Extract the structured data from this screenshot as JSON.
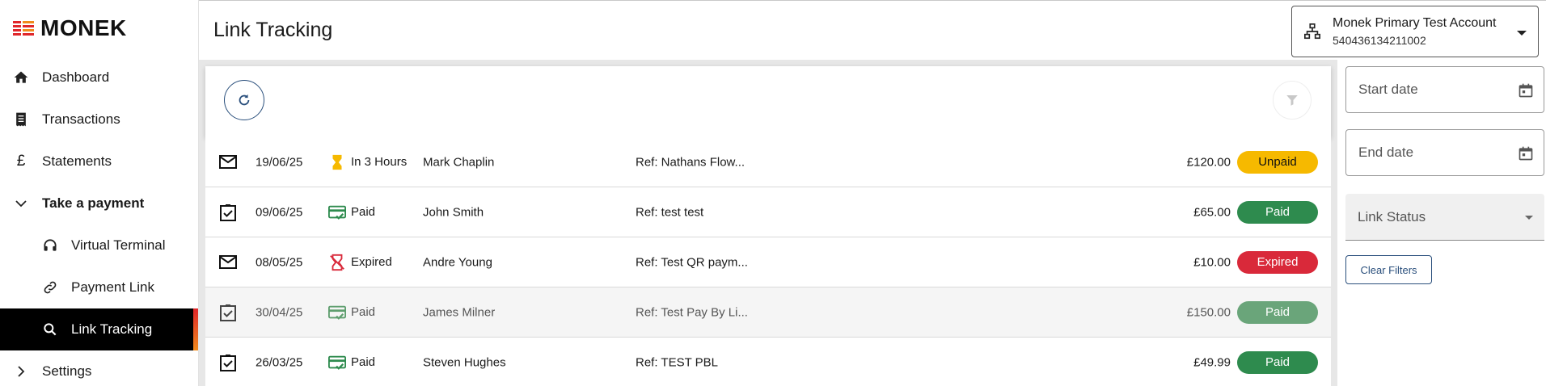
{
  "brand": {
    "name": "MONEK"
  },
  "sidebar": {
    "items": [
      {
        "label": "Dashboard",
        "icon": "home-icon"
      },
      {
        "label": "Transactions",
        "icon": "receipt-icon"
      },
      {
        "label": "Statements",
        "icon": "pound-icon"
      },
      {
        "label": "Take a payment",
        "icon": "chevron-down-icon"
      },
      {
        "label": "Virtual Terminal",
        "icon": "headset-icon"
      },
      {
        "label": "Payment Link",
        "icon": "link-icon"
      },
      {
        "label": "Link Tracking",
        "icon": "search-list-icon"
      },
      {
        "label": "Settings",
        "icon": "chevron-right-icon"
      }
    ]
  },
  "header": {
    "title": "Link Tracking",
    "account": {
      "name": "Monek Primary Test Account",
      "id": "540436134211002"
    }
  },
  "colors": {
    "unpaid": "#f6b900",
    "paid": "#2e8b4e",
    "paid_hover": "#6aa57a",
    "expired": "#d9293a",
    "accent_blue": "#2a4f7c",
    "pending_icon": "#f6b900",
    "paid_icon": "#2e8b4e",
    "expired_icon": "#d9293a"
  },
  "links": [
    {
      "type_icon": "mail-icon",
      "date": "19/06/25",
      "status_icon": "hourglass-icon",
      "status_text": "In 3 Hours",
      "name": "Mark Chaplin",
      "ref": "Ref: Nathans Flow...",
      "amount": "£120.00",
      "badge": "Unpaid"
    },
    {
      "type_icon": "checklist-icon",
      "date": "09/06/25",
      "status_icon": "card-check-icon",
      "status_text": "Paid",
      "name": "John Smith",
      "ref": "Ref: test test",
      "amount": "£65.00",
      "badge": "Paid"
    },
    {
      "type_icon": "mail-icon",
      "date": "08/05/25",
      "status_icon": "hourglass-off-icon",
      "status_text": "Expired",
      "name": "Andre Young",
      "ref": "Ref: Test QR paym...",
      "amount": "£10.00",
      "badge": "Expired"
    },
    {
      "type_icon": "checklist-icon",
      "date": "30/04/25",
      "status_icon": "card-check-icon",
      "status_text": "Paid",
      "name": "James Milner",
      "ref": "Ref: Test Pay By Li...",
      "amount": "£150.00",
      "badge": "Paid"
    },
    {
      "type_icon": "checklist-icon",
      "date": "26/03/25",
      "status_icon": "card-check-icon",
      "status_text": "Paid",
      "name": "Steven Hughes",
      "ref": "Ref: TEST PBL",
      "amount": "£49.99",
      "badge": "Paid"
    }
  ],
  "filters": {
    "start_placeholder": "Start date",
    "end_placeholder": "End date",
    "status_label": "Link Status",
    "clear_label": "Clear Filters"
  }
}
